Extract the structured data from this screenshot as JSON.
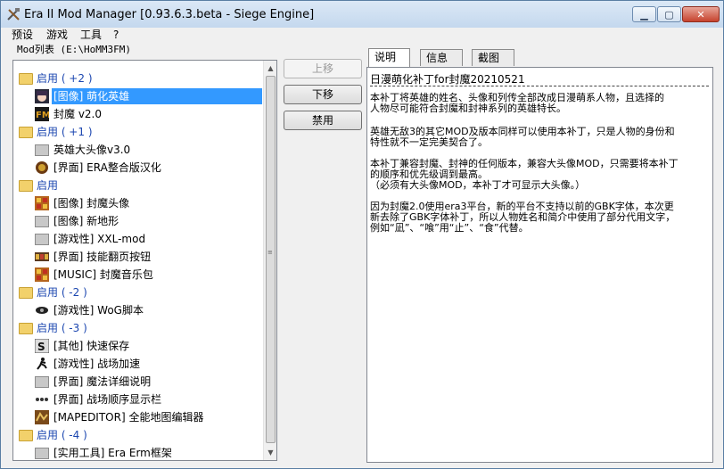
{
  "window": {
    "title": "Era II Mod Manager [0.93.6.3.beta - Siege Engine]",
    "controls": {
      "minimize": "▁",
      "maximize": "▢",
      "close": "✕"
    }
  },
  "menu": {
    "items": [
      "预设",
      "游戏",
      "工具",
      "?"
    ]
  },
  "path_label": "Mod列表 (E:\\HoMM3FM)",
  "mod_list": {
    "rows": [
      {
        "kind": "group",
        "label": "启用 ( +2 )",
        "icon": "folder-icon"
      },
      {
        "kind": "item",
        "label": "[图像] 萌化英雄",
        "icon": "anime-girl-icon",
        "selected": true
      },
      {
        "kind": "item",
        "label": "封魔 v2.0",
        "icon": "fm-logo-icon"
      },
      {
        "kind": "group",
        "label": "启用 ( +1 )",
        "icon": "folder-icon"
      },
      {
        "kind": "item",
        "label": "英雄大头像v3.0",
        "icon": "gray-folder-icon"
      },
      {
        "kind": "item",
        "label": "[界面] ERA整合版汉化",
        "icon": "shield-crest-icon"
      },
      {
        "kind": "group",
        "label": "启用",
        "icon": "folder-icon"
      },
      {
        "kind": "item",
        "label": "[图像] 封魔头像",
        "icon": "portrait-grid-icon"
      },
      {
        "kind": "item",
        "label": "[图像] 新地形",
        "icon": "gray-folder-icon"
      },
      {
        "kind": "item",
        "label": "[游戏性] XXL-mod",
        "icon": "gray-folder-icon"
      },
      {
        "kind": "item",
        "label": "[界面] 技能翻页按钮",
        "icon": "skill-bar-icon"
      },
      {
        "kind": "item",
        "label": "[MUSIC] 封魔音乐包",
        "icon": "portrait-grid-icon"
      },
      {
        "kind": "group",
        "label": "启用 ( -2 )",
        "icon": "folder-icon"
      },
      {
        "kind": "item",
        "label": "[游戏性] WoG脚本",
        "icon": "wog-eye-icon"
      },
      {
        "kind": "group",
        "label": "启用 ( -3 )",
        "icon": "folder-icon"
      },
      {
        "kind": "item",
        "label": "[其他] 快速保存",
        "icon": "save-s-icon"
      },
      {
        "kind": "item",
        "label": "[游戏性] 战场加速",
        "icon": "running-man-icon"
      },
      {
        "kind": "item",
        "label": "[界面] 魔法详细说明",
        "icon": "gray-folder-icon"
      },
      {
        "kind": "item",
        "label": "[界面] 战场顺序显示栏",
        "icon": "unit-order-icon"
      },
      {
        "kind": "item",
        "label": "[MAPEDITOR] 全能地图编辑器",
        "icon": "map-editor-icon"
      },
      {
        "kind": "group",
        "label": "启用 ( -4 )",
        "icon": "folder-icon"
      },
      {
        "kind": "item",
        "label": "[实用工具] Era Erm框架",
        "icon": "gray-folder-icon"
      }
    ]
  },
  "actions": {
    "move_up": "上移",
    "move_down": "下移",
    "disable": "禁用"
  },
  "tabs": [
    "说明",
    "信息",
    "截图"
  ],
  "description": {
    "title": "日漫萌化补丁for封魔20210521",
    "paragraphs": [
      [
        "本补丁将英雄的姓名、头像和列传全部改成日漫萌系人物，且选择的",
        "人物尽可能符合封魔和封神系列的英雄特长。"
      ],
      [
        "英雄无敌3的其它MOD及版本同样可以使用本补丁，只是人物的身份和",
        "特性就不一定完美契合了。"
      ],
      [
        "本补丁兼容封魔、封神的任何版本，兼容大头像MOD，只需要将本补丁",
        "的顺序和优先级调到最高。",
        "（必须有大头像MOD，本补丁才可显示大头像。）"
      ],
      [
        "因为封魔2.0使用era3平台，新的平台不支持以前的GBK字体，本次更",
        "新去除了GBK字体补丁，所以人物姓名和简介中使用了部分代用文字，",
        "例如“凪”、“喰”用“止”、“食”代替。"
      ]
    ]
  }
}
